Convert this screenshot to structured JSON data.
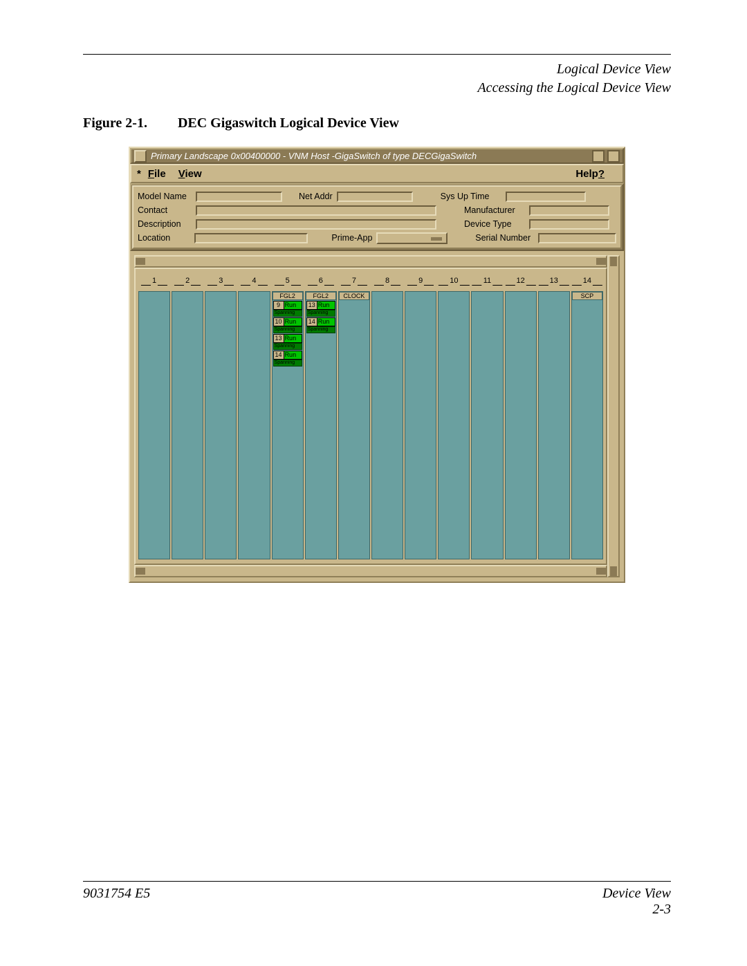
{
  "header": {
    "section": "Logical Device View",
    "subsection": "Accessing the Logical Device View"
  },
  "caption": {
    "figure": "Figure 2-1.",
    "title": "DEC Gigaswitch Logical Device View"
  },
  "window": {
    "title": "Primary Landscape 0x00400000 - VNM Host -GigaSwitch of type DECGigaSwitch"
  },
  "menubar": {
    "star": "*",
    "file_first": "F",
    "file_rest": "ile",
    "view_first": "V",
    "view_rest": "iew",
    "help_main": "Help",
    "help_u": "?"
  },
  "info": {
    "model_name": "Model Name",
    "net_addr": "Net Addr",
    "contact": "Contact",
    "description": "Description",
    "location": "Location",
    "prime_app": "Prime-App",
    "sys_up_time": "Sys Up Time",
    "manufacturer": "Manufacturer",
    "device_type": "Device Type",
    "serial_number": "Serial Number"
  },
  "slots": [
    {
      "num": "1"
    },
    {
      "num": "2"
    },
    {
      "num": "3"
    },
    {
      "num": "4"
    },
    {
      "num": "5",
      "card": "FGL2",
      "ports": [
        {
          "n": "9",
          "s": "Run",
          "span": "Spanning"
        },
        {
          "n": "10",
          "s": "Run",
          "span": "Spanning"
        },
        {
          "n": "13",
          "s": "Run",
          "span": "Spanning"
        },
        {
          "n": "14",
          "s": "Run",
          "span": "Spanning"
        }
      ]
    },
    {
      "num": "6",
      "card": "FGL2",
      "ports": [
        {
          "n": "13",
          "s": "Run",
          "span": "Spanning"
        },
        {
          "n": "14",
          "s": "Run",
          "span": "Spanning"
        }
      ]
    },
    {
      "num": "7",
      "card": "CLOCK"
    },
    {
      "num": "8"
    },
    {
      "num": "9"
    },
    {
      "num": "10"
    },
    {
      "num": "11"
    },
    {
      "num": "12"
    },
    {
      "num": "13"
    },
    {
      "num": "14",
      "card": "SCP"
    }
  ],
  "footer": {
    "left": "9031754 E5",
    "right_top": "Device View",
    "right_bottom": "2-3"
  }
}
